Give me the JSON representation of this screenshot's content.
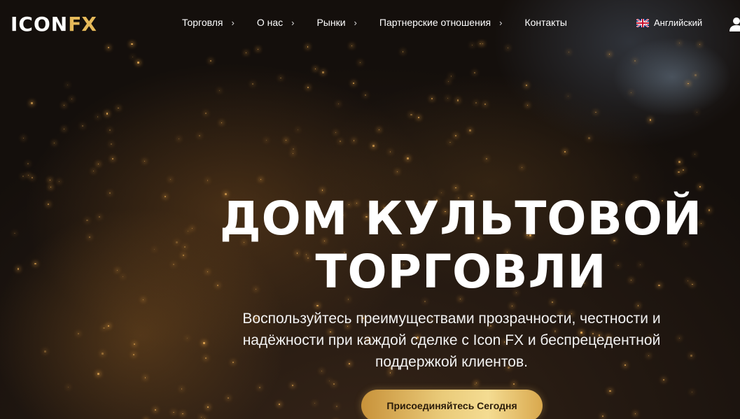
{
  "header": {
    "logo": {
      "part1": "ICON",
      "part2": "FX"
    },
    "nav": [
      {
        "label": "Торговля",
        "has_submenu": true
      },
      {
        "label": "О нас",
        "has_submenu": true
      },
      {
        "label": "Рынки",
        "has_submenu": true
      },
      {
        "label": "Партнерские отношения",
        "has_submenu": true
      },
      {
        "label": "Контакты",
        "has_submenu": false
      }
    ],
    "chevron": "›",
    "language": {
      "label": "Английский",
      "flag_icon": "uk-flag-icon"
    },
    "user_icon": "user-icon"
  },
  "hero": {
    "headline_line1": "ДОМ КУЛЬТОВОЙ",
    "headline_line2": "ТОРГОВЛИ",
    "subtitle": "Воспользуйтесь преимуществами прозрачности, честности и надёжности при каждой сделке с Icon FX и беспрецедентной поддержкой клиентов.",
    "cta_label": "Присоединяйтесь Сегодня"
  },
  "colors": {
    "accent_gold": "#e5b95a",
    "background": "#1a1411",
    "cta_text": "#2b1c0a"
  }
}
